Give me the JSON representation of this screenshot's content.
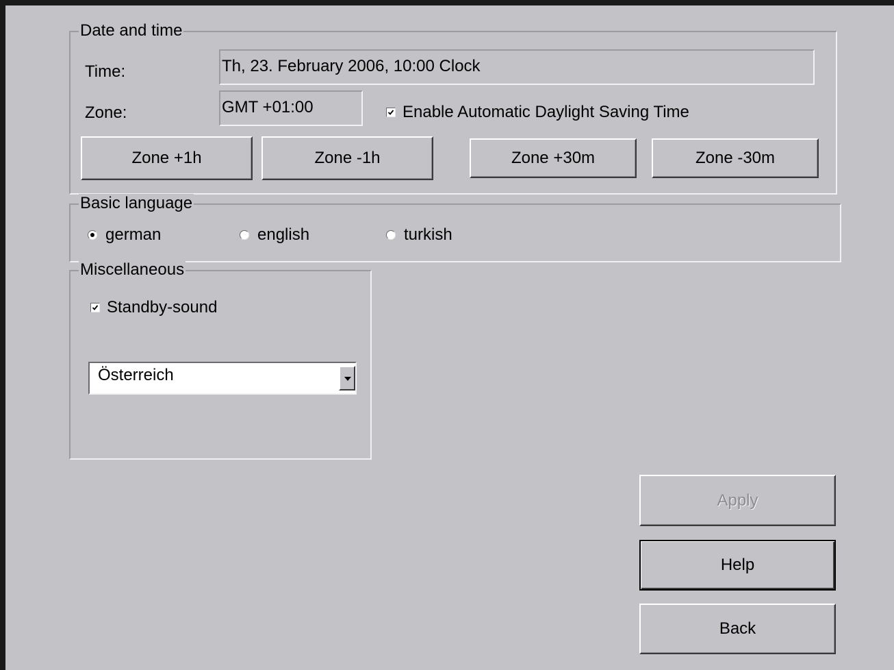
{
  "date_time": {
    "title": "Date and time",
    "time_label": "Time:",
    "time_value": "Th, 23. February 2006, 10:00 Clock",
    "zone_label": "Zone:",
    "zone_value": "GMT +01:00",
    "dst_label": "Enable Automatic Daylight Saving Time",
    "dst_checked": true,
    "buttons": {
      "zone_plus_1h": "Zone +1h",
      "zone_minus_1h": "Zone -1h",
      "zone_plus_30m": "Zone +30m",
      "zone_minus_30m": "Zone -30m"
    }
  },
  "basic_language": {
    "title": "Basic language",
    "options": [
      {
        "label": "german",
        "selected": true
      },
      {
        "label": "english",
        "selected": false
      },
      {
        "label": "turkish",
        "selected": false
      }
    ]
  },
  "miscellaneous": {
    "title": "Miscellaneous",
    "standby_sound_label": "Standby-sound",
    "standby_sound_checked": true,
    "country_selected": "Österreich"
  },
  "actions": {
    "apply": "Apply",
    "help": "Help",
    "back": "Back"
  }
}
